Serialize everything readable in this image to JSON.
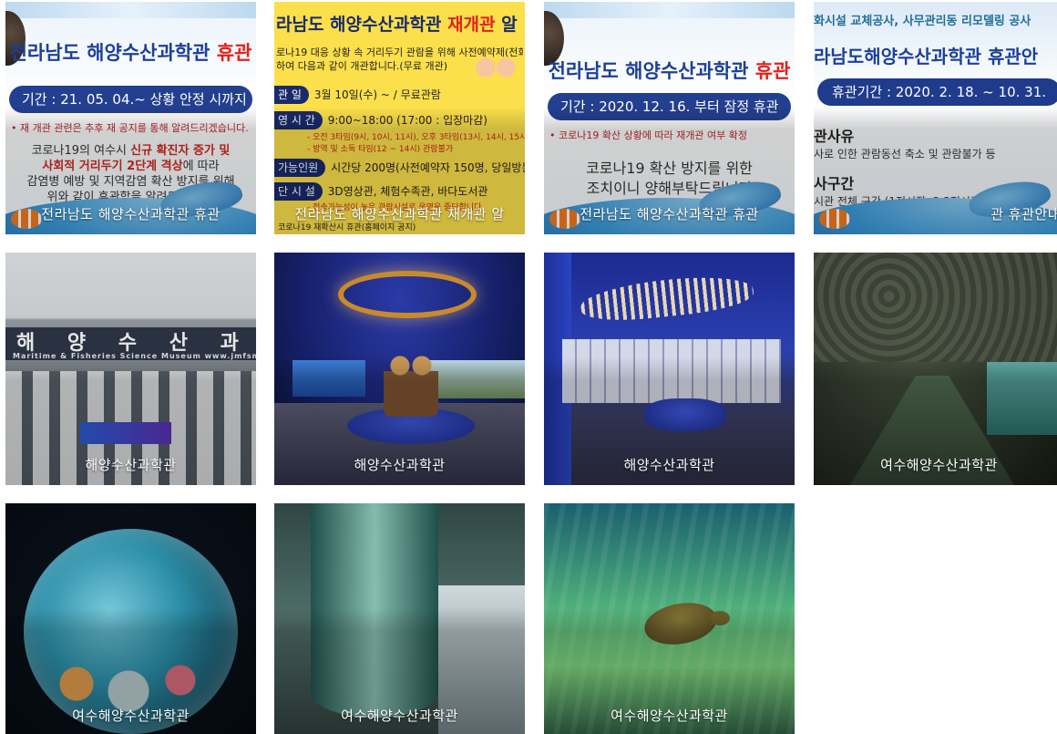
{
  "tiles": [
    {
      "caption": "전라남도 해양수산과학관 휴관",
      "notice": {
        "headline_main": "전라남도 해양수산과학관 ",
        "headline_red": "휴관",
        "period": "기간 : 21. 05. 04.~ 상황 안정 시까지",
        "note": "• 재 개관 관련은 추후 재 공지를 통해 알려드리겠습니다.",
        "body_line1_pre": "코로나19의 여수시 ",
        "body_line1_hl": "신규 확진자 증가 및",
        "body_line2_hl": "사회적 거리두기 2단계 격상",
        "body_line2_post": "에 따라",
        "body_line3": "감염병 예방 및 지역감염 확산 방지를 위해",
        "body_line4": "위와 같이 휴관함을 알려드립니다."
      }
    },
    {
      "caption": "전라남도 해양수산과학관 재개관 알",
      "notice": {
        "title_main": "라남도 해양수산과학관 ",
        "title_red": "재개관",
        "title_tail": " 알",
        "intro_line1": "로나19 대응 상황 속 거리두기 관람을 위해 사전예약제(전화)를",
        "intro_line2": "하여 다음과 같이 개관합니다.(무료 개관)",
        "rows": [
          {
            "tag": "관 일",
            "text": "3월 10일(수) ~ / 무료관람"
          },
          {
            "tag": "영 시 간",
            "text": "9:00~18:00 (17:00 : 입장마감)"
          },
          {
            "tag": "가능인원",
            "text": "시간당 200명(사전예약자 150명, 당일방문자 5"
          },
          {
            "tag": "단 시 설",
            "text": "3D영상관, 체험수족관, 바다도서관"
          }
        ],
        "sub1": "- 오전 3타임(9시, 10시, 11시), 오후 3타임(13시, 14시, 15시",
        "sub2": "- 방역 및 소독 타임(12 ~ 14시) 관람불가",
        "sub3": "- 전송가능성이 높은 관람시설로 운영을 중단합니다",
        "footer": "코로나19 재확산시 휴관(홈페이지 공지)"
      }
    },
    {
      "caption": "전라남도 해양수산과학관 휴관",
      "notice": {
        "headline_main": "전라남도 해양수산과학관 ",
        "headline_red": "휴관",
        "period": "기간 : 2020. 12. 16. 부터 잠정 휴관",
        "note": "• 코로나19 확산 상황에 따라 재개관 여부 확정",
        "body_line1": "코로나19 확산 방지를 위한",
        "body_line2": "조치이니 양해부탁드립니다"
      }
    },
    {
      "caption": "관 휴관안내",
      "notice": {
        "top": "화시설 교체공사, 사무관리동 리모델링 공사",
        "headline": "라남도해양수산과학관 휴관안",
        "period": "휴관기간 : 2020. 2. 18. ~ 10. 31.",
        "reason_title": "관사유",
        "reason_text": "사로 인한 관람동선 축소 및 관람불가 등",
        "area_title": "사구간",
        "area_text": "시관 전체 구간 (1전시장, 2·3전시장, 사무관리동"
      }
    },
    {
      "caption": "해양수산과학관",
      "sign": "해 양 수 산 과 학 관",
      "sign_sub": "Maritime & Fisheries Science Museum   www.jmfsm.or.kr"
    },
    {
      "caption": "해양수산과학관"
    },
    {
      "caption": "해양수산과학관"
    },
    {
      "caption": "여수해양수산과학관"
    },
    {
      "caption": "여수해양수산과학관"
    },
    {
      "caption": "여수해양수산과학관"
    },
    {
      "caption": "여수해양수산과학관"
    }
  ]
}
